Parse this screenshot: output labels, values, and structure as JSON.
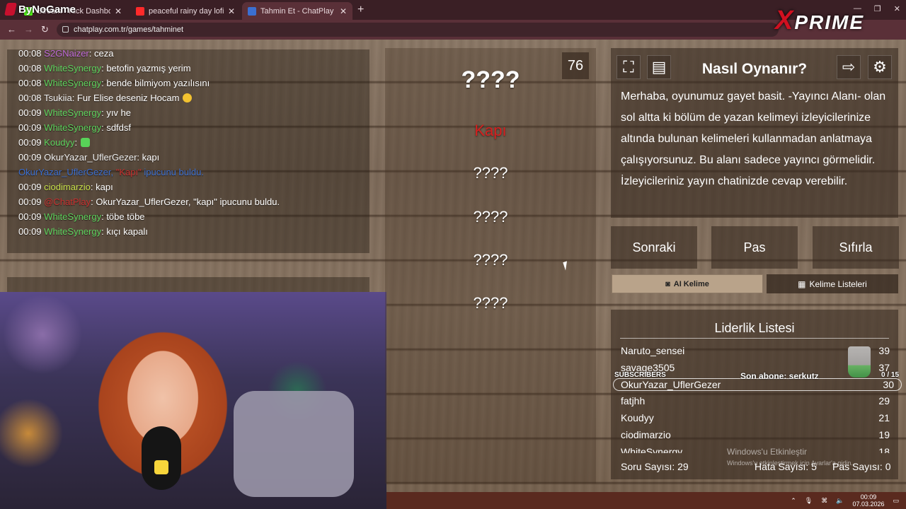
{
  "browser": {
    "tabs": [
      {
        "title": "Stream - Kick Dashboard"
      },
      {
        "title": "peaceful rainy day lofi ☁"
      },
      {
        "title": "Tahmin Et - ChatPlay"
      }
    ],
    "url": "chatplay.com.tr/games/tahminet"
  },
  "overlay": {
    "brand": "ByNoGame",
    "xprime_x": "X",
    "xprime_text": "PRIME"
  },
  "chat": {
    "lines": [
      {
        "time": "00:08",
        "user": "S2GNaizer",
        "color": "#c06bd8",
        "msg": ": ceza"
      },
      {
        "time": "00:08",
        "user": "WhiteSynergy",
        "color": "#5fd35f",
        "msg": ": betofin yazmış yerim"
      },
      {
        "time": "00:08",
        "user": "WhiteSynergy",
        "color": "#5fd35f",
        "msg": ": bende bilmiyom yazılısını"
      },
      {
        "time": "00:08",
        "user": "Tsukiia",
        "color": "#f0f0f0",
        "msg": ": Fur Elise deseniz Hocam"
      },
      {
        "time": "00:09",
        "user": "WhiteSynergy",
        "color": "#5fd35f",
        "msg": ": yıv he"
      },
      {
        "time": "00:09",
        "user": "WhiteSynergy",
        "color": "#5fd35f",
        "msg": ": sdfdsf"
      },
      {
        "time": "00:09",
        "user": "Koudyy",
        "color": "#5fd35f",
        "msg": ":"
      },
      {
        "time": "00:09",
        "user": "OkurYazar_UflerGezer",
        "color": "#f0f0f0",
        "msg": ": kapı"
      },
      {
        "time": "",
        "user": "OkurYazar_UflerGezer,",
        "color": "#3b6fd1",
        "msg": "ipucunu buldu.",
        "hint": "\"Kapı\""
      },
      {
        "time": "00:09",
        "user": "ciodimarzio",
        "color": "#c8e04a",
        "msg": ": kapı"
      },
      {
        "time": "00:09",
        "user": "@ChatPlay",
        "color": "#c8302f",
        "msg": ": OkurYazar_UflerGezer, \"kapı\" ipucunu buldu."
      },
      {
        "time": "00:09",
        "user": "WhiteSynergy",
        "color": "#5fd35f",
        "msg": ": töbe töbe"
      },
      {
        "time": "00:09",
        "user": "WhiteSynergy",
        "color": "#5fd35f",
        "msg": ": kıçı kapalı"
      }
    ]
  },
  "game": {
    "counter": "76",
    "main_word": "????",
    "hint_found": "Kapı",
    "hints": [
      "????",
      "????",
      "????",
      "????"
    ]
  },
  "howto": {
    "title": "Nasıl Oynanır?",
    "text": "Merhaba, oyunumuz gayet basit. -Yayıncı Alanı- olan sol altta ki bölüm de yazan kelimeyi izleyicilerinize altında bulunan kelimeleri kullanmadan anlatmaya çalışıyorsunuz. Bu alanı sadece yayıncı görmelidir. İzleyicileriniz yayın chatinizde cevap verebilir."
  },
  "actions": {
    "next": "Sonraki",
    "pass": "Pas",
    "reset": "Sıfırla",
    "ai_word": "AI Kelime",
    "word_lists": "Kelime Listeleri"
  },
  "leaderboard": {
    "title": "Liderlik Listesi",
    "rows": [
      {
        "name": "Naruto_sensei",
        "score": "39"
      },
      {
        "name": "savage3505",
        "score": "37"
      },
      {
        "name": "OkurYazar_UflerGezer",
        "score": "30"
      },
      {
        "name": "fatjhh",
        "score": "29"
      },
      {
        "name": "Koudyy",
        "score": "21"
      },
      {
        "name": "ciodimarzio",
        "score": "19"
      },
      {
        "name": "WhiteSynergy",
        "score": "18"
      }
    ],
    "question_count": "Soru Sayısı: 29",
    "error_count": "Hata Sayısı: 5",
    "pass_count": "Pas Sayısı: 0"
  },
  "subs": {
    "label": "SUBSCRIBERS",
    "last": "Son abone: serkutz",
    "goal": "0 / 15"
  },
  "windows": {
    "activate": "Windows'u Etkinleştir",
    "activate_sub": "Windows'u etkinleştirmek için Ayarlar'a gidin."
  },
  "tray": {
    "time": "00:09",
    "date": "07.03.2026"
  }
}
